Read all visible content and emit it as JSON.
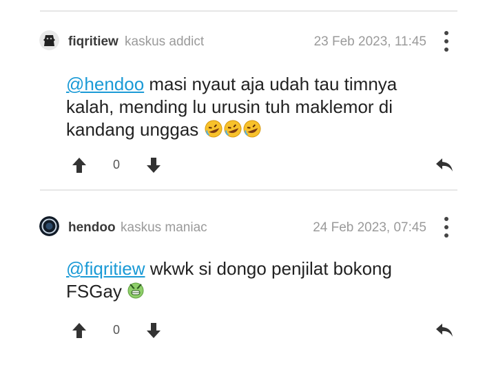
{
  "comments": [
    {
      "username": "fiqritiew",
      "rank": "kaskus addict",
      "timestamp": "23 Feb 2023, 11:45",
      "mention": "@hendoo",
      "line1_rest": " masi nyaut aja udah tau timnya",
      "line2": "kalah, mending lu urusin tuh maklemor di",
      "line3": "kandang unggas",
      "emojis": [
        "rofl-emoji",
        "rofl-emoji",
        "rofl-emoji"
      ],
      "vote_count": "0",
      "avatar_color": "#2b2b2b"
    },
    {
      "username": "hendoo",
      "rank": "kaskus maniac",
      "timestamp": "24 Feb 2023, 07:45",
      "mention": "@fiqritiew",
      "line1_rest": " wkwk si dongo penjilat bokong",
      "line2": "FSGay",
      "emojis": [
        "vomit-emoji"
      ],
      "vote_count": "0",
      "avatar_color": "#1c2a3a"
    }
  ],
  "colors": {
    "mention": "#1a9ad6",
    "meta": "#9a9a9a",
    "divider": "#e6e6e6"
  }
}
